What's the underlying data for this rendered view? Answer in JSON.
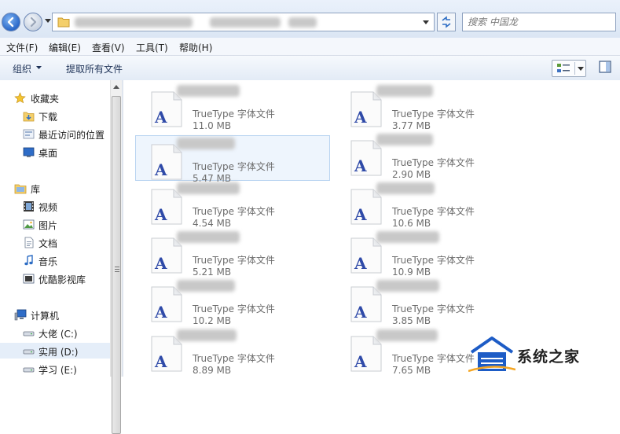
{
  "address_bar": {
    "search_placeholder": "搜索 中国龙"
  },
  "menu": {
    "items": [
      "文件(F)",
      "编辑(E)",
      "查看(V)",
      "工具(T)",
      "帮助(H)"
    ]
  },
  "toolbar": {
    "organize_label": "组织",
    "extract_label": "提取所有文件"
  },
  "nav_pane": {
    "favorites": {
      "label": "收藏夹",
      "items": [
        "下载",
        "最近访问的位置",
        "桌面"
      ]
    },
    "libraries": {
      "label": "库",
      "items": [
        "视频",
        "图片",
        "文档",
        "音乐",
        "优酷影视库"
      ]
    },
    "computer": {
      "label": "计算机",
      "drives": [
        "大佬 (C:)",
        "实用 (D:)",
        "学习 (E:)"
      ],
      "selected_drive": "实用 (D:)"
    }
  },
  "files": {
    "type_label": "TrueType 字体文件",
    "icon_letter": "A",
    "items": [
      {
        "size": "11.0 MB"
      },
      {
        "size": "3.77 MB"
      },
      {
        "size": "5.47 MB",
        "selected": true
      },
      {
        "size": "2.90 MB"
      },
      {
        "size": "4.54 MB"
      },
      {
        "size": "10.6 MB"
      },
      {
        "size": "5.21 MB"
      },
      {
        "size": "10.9 MB"
      },
      {
        "size": "10.2 MB"
      },
      {
        "size": "3.85 MB"
      },
      {
        "size": "8.89 MB"
      },
      {
        "size": "7.65 MB"
      }
    ]
  },
  "watermark": {
    "text": "系统之家"
  },
  "colors": {
    "accent": "#2a68c8",
    "selection": "#eef5fd",
    "font_icon_letter": "#2f4aa8"
  }
}
